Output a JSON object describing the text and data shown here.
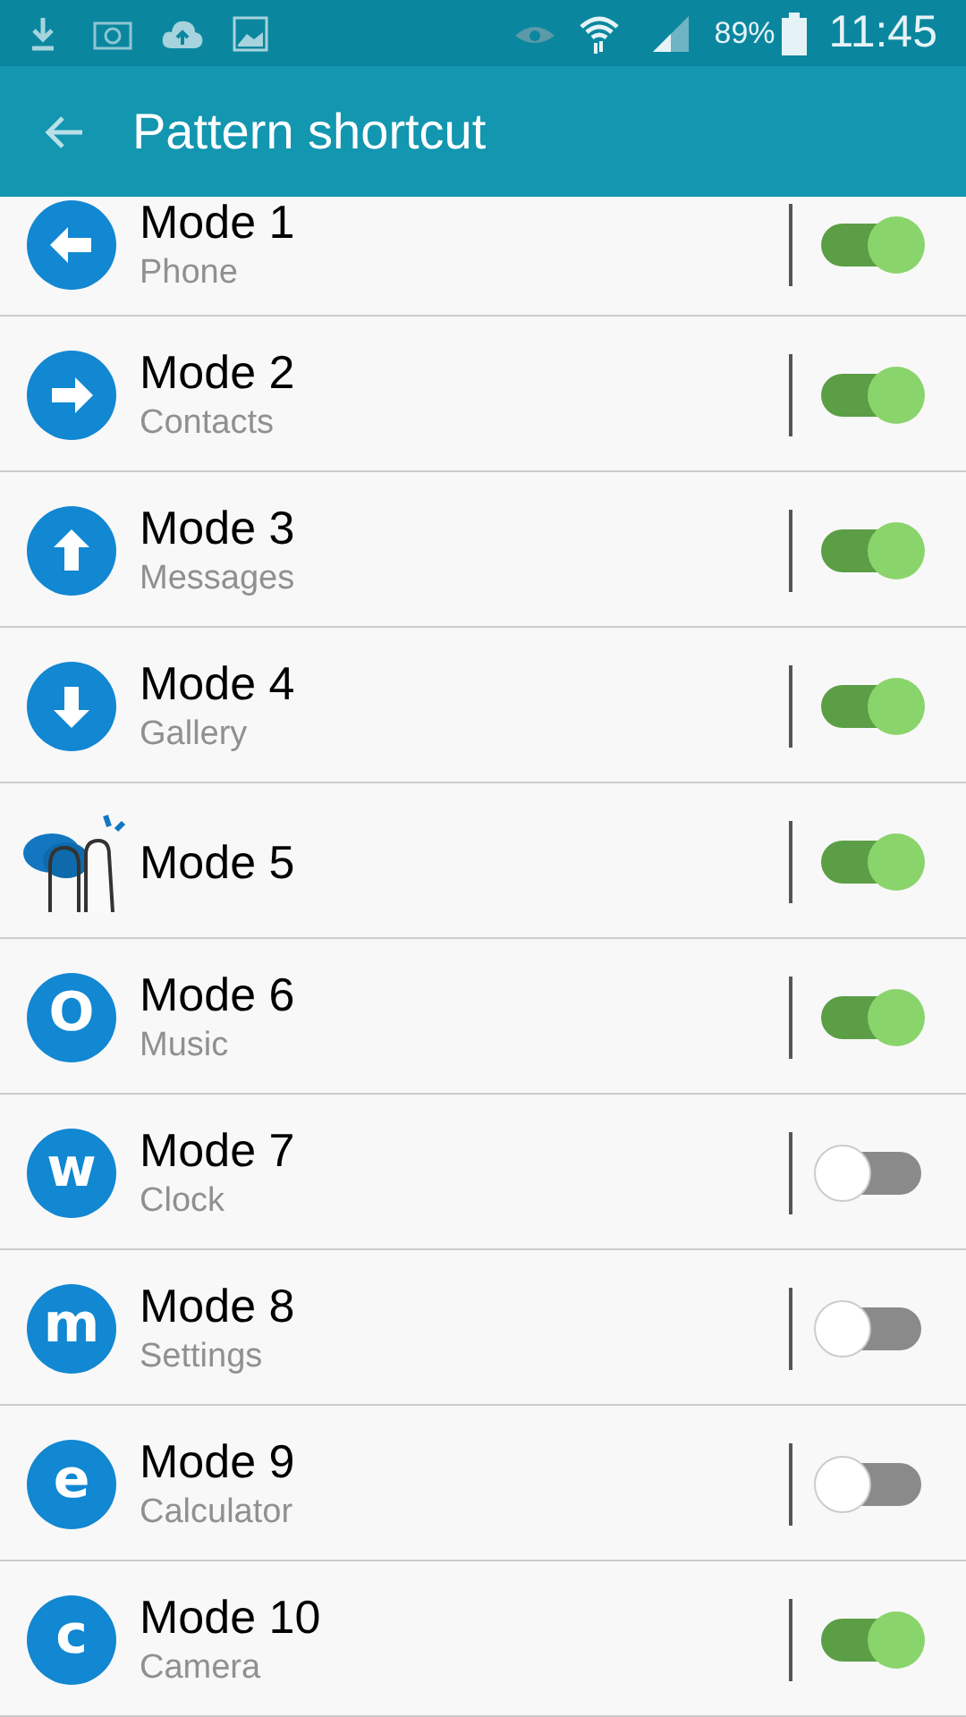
{
  "status_bar": {
    "battery_text": "89%",
    "time": "11:45"
  },
  "app_bar": {
    "title": "Pattern shortcut"
  },
  "items": [
    {
      "title": "Mode 1",
      "subtitle": "Phone",
      "kind": "arrow-left",
      "on": true
    },
    {
      "title": "Mode 2",
      "subtitle": "Contacts",
      "kind": "arrow-right",
      "on": true
    },
    {
      "title": "Mode 3",
      "subtitle": "Messages",
      "kind": "arrow-up",
      "on": true
    },
    {
      "title": "Mode 4",
      "subtitle": "Gallery",
      "kind": "arrow-down",
      "on": true
    },
    {
      "title": "Mode 5",
      "kind": "gesture",
      "on": true
    },
    {
      "title": "Mode 6",
      "subtitle": "Music",
      "kind": "letter",
      "glyph": "O",
      "on": true
    },
    {
      "title": "Mode 7",
      "subtitle": "Clock",
      "kind": "letter",
      "glyph": "w",
      "on": false
    },
    {
      "title": "Mode 8",
      "subtitle": "Settings",
      "kind": "letter",
      "glyph": "m",
      "on": false
    },
    {
      "title": "Mode 9",
      "subtitle": "Calculator",
      "kind": "letter",
      "glyph": "e",
      "on": false
    },
    {
      "title": "Mode 10",
      "subtitle": "Camera",
      "kind": "letter",
      "glyph": "c",
      "on": true
    }
  ]
}
